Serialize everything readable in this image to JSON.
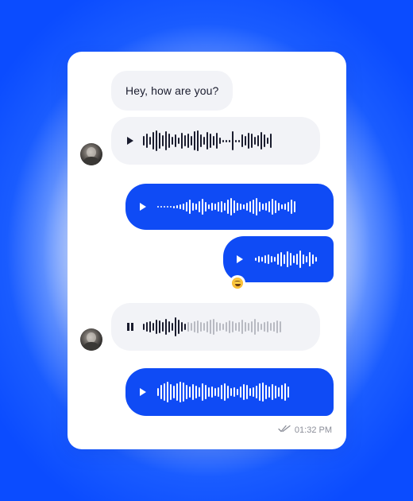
{
  "messages": {
    "m1_text": "Hey, how are you?",
    "voice_in_1": {
      "state": "paused",
      "icon": "play-icon"
    },
    "voice_out_1": {
      "state": "paused",
      "icon": "play-icon"
    },
    "voice_out_2": {
      "state": "paused",
      "icon": "play-icon",
      "reaction": "laughing-emoji"
    },
    "voice_in_2": {
      "state": "playing",
      "icon": "pause-icon"
    },
    "voice_out_3": {
      "state": "paused",
      "icon": "play-icon"
    }
  },
  "footer": {
    "time": "01:32 PM",
    "status_icon": "double-check-icon"
  },
  "colors": {
    "accent": "#0f4bf5",
    "incoming_bubble": "#f2f3f7",
    "text": "#1a1c2e"
  }
}
